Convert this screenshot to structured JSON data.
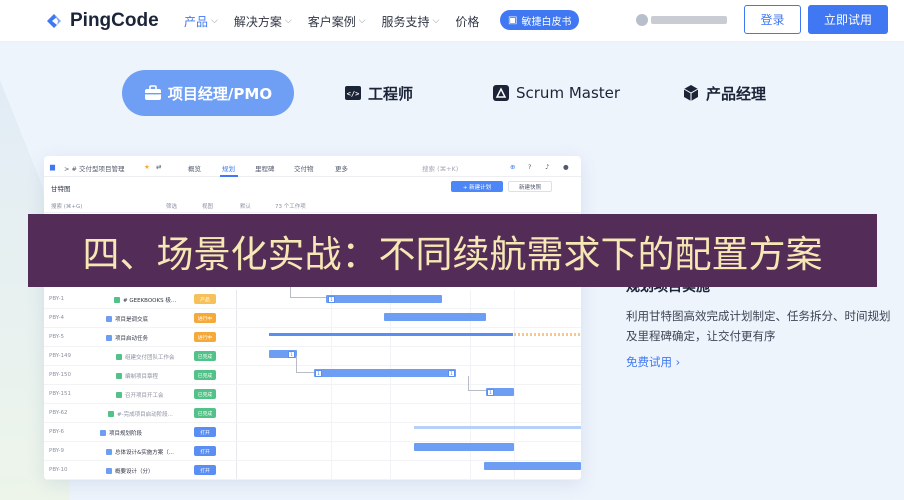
{
  "nav": {
    "logo": "PingCode",
    "menu": [
      {
        "label": "产品",
        "caret": true,
        "active": true
      },
      {
        "label": "解决方案",
        "caret": true
      },
      {
        "label": "客户案例",
        "caret": true
      },
      {
        "label": "服务支持",
        "caret": true
      },
      {
        "label": "价格",
        "caret": false
      }
    ],
    "whitepaper": "敏捷白皮书",
    "login": "登录",
    "trial": "立即试用"
  },
  "roles": [
    {
      "label": "项目经理/PMO",
      "icon": "briefcase-icon",
      "active": true
    },
    {
      "label": "工程师",
      "icon": "code-icon"
    },
    {
      "label": "Scrum Master",
      "icon": "scrum-icon"
    },
    {
      "label": "产品经理",
      "icon": "cube-icon"
    }
  ],
  "app": {
    "breadcrumb": "> # 交付型项目管理",
    "tabs": [
      "概览",
      "规划",
      "里程碑",
      "交付物",
      "更多"
    ],
    "active_tab": "规划",
    "search_placeholder": "搜索 (⌘+K)",
    "view_title": "甘特图",
    "new_plan": "+ 新建计划",
    "snapshot": "新建快照",
    "toolbar": {
      "search": "搜索 (⌘+G)",
      "filter": "筛选",
      "view": "视图",
      "default": "默认",
      "count": "73 个工作项"
    },
    "rows": [
      {
        "id": "PBY-1",
        "title": "# GEEKBOOKS 极...",
        "status": "产品",
        "status_color": "#f6c15b",
        "cb": "#53c288",
        "indent": 70,
        "done": false
      },
      {
        "id": "PBY-4",
        "title": "项目是调交底",
        "status": "进行中",
        "status_color": "#f6a93b",
        "cb": "#6d9ef3",
        "indent": 62,
        "done": false
      },
      {
        "id": "PBY-5",
        "title": "项目启动任务",
        "status": "进行中",
        "status_color": "#f6a93b",
        "cb": "#6d9ef3",
        "indent": 62,
        "done": false
      },
      {
        "id": "PBY-149",
        "title": "组建交付团队工作会",
        "status": "已完成",
        "status_color": "#53c288",
        "cb": "#53c288",
        "indent": 72,
        "done": true
      },
      {
        "id": "PBY-150",
        "title": "编制项目章程",
        "status": "已完成",
        "status_color": "#53c288",
        "cb": "#53c288",
        "indent": 72,
        "done": true
      },
      {
        "id": "PBY-151",
        "title": "召开项目开工会",
        "status": "已完成",
        "status_color": "#53c288",
        "cb": "#53c288",
        "indent": 72,
        "done": true
      },
      {
        "id": "PBY-62",
        "title": "#-完成项目启动阶段...",
        "status": "已完成",
        "status_color": "#53c288",
        "cb": "#53c288",
        "indent": 64,
        "done": true
      },
      {
        "id": "PBY-6",
        "title": "项目规划阶段",
        "status": "打开",
        "status_color": "#5b8ef2",
        "cb": "#6d9ef3",
        "indent": 56,
        "done": false
      },
      {
        "id": "PBY-9",
        "title": "总体设计&实施方案（...",
        "status": "打开",
        "status_color": "#5b8ef2",
        "cb": "#6d9ef3",
        "indent": 62,
        "done": false
      },
      {
        "id": "PBY-10",
        "title": "概要设计（分）",
        "status": "打开",
        "status_color": "#5b8ef2",
        "cb": "#6d9ef3",
        "indent": 62,
        "done": false
      }
    ]
  },
  "feature": {
    "title": "规划项目实施",
    "desc": "利用甘特图高效完成计划制定、任务拆分、时间规划及里程碑确定，让交付更有序",
    "link": "免费试用 ›"
  },
  "overlay": {
    "text": "四、场景化实战：不同续航需求下的配置方案"
  },
  "colors": {
    "accent": "#3f78f2",
    "active_role": "#6e9ff5",
    "overlay_bg": "#532d58",
    "overlay_text": "#f6e8b4"
  }
}
